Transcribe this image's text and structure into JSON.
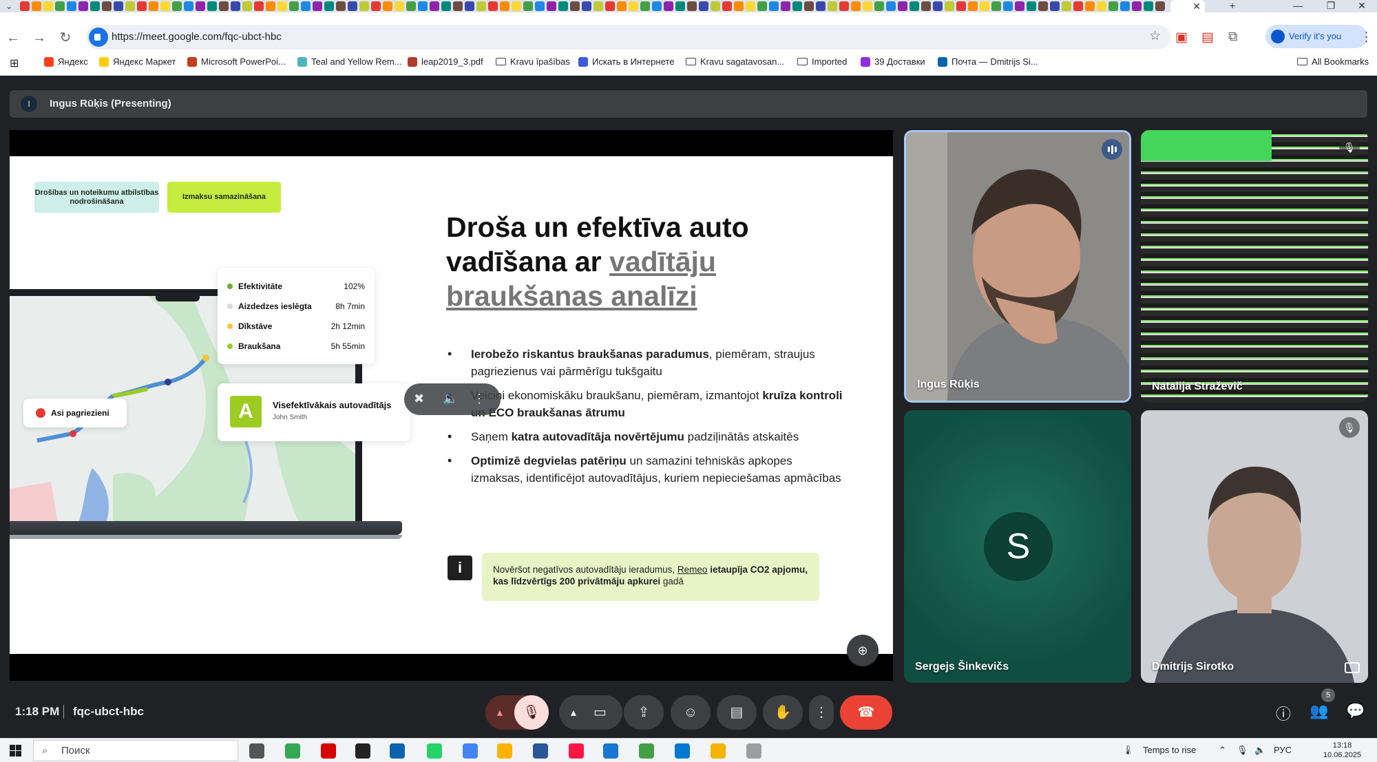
{
  "browser": {
    "url": "https://meet.google.com/fqc-ubct-hbc",
    "verify_label": "Verify it's you",
    "tab_close": "✕",
    "new_tab": "+",
    "bookmarks": [
      {
        "label": "Яндекс",
        "color": "#fc3f1d"
      },
      {
        "label": "Яндекс Маркет",
        "color": "#ffcc00"
      },
      {
        "label": "Microsoft PowerPoi...",
        "color": "#c43e1c"
      },
      {
        "label": "Teal and Yellow Rem...",
        "color": "#4fb3bf"
      },
      {
        "label": "leap2019_3.pdf",
        "color": "#b03a2e"
      },
      {
        "label": "Kravu īpašības",
        "folder": true
      },
      {
        "label": "Искать в Интернете",
        "color": "#3b5bdb"
      },
      {
        "label": "Kravu sagatavosan...",
        "folder": true
      },
      {
        "label": "Imported",
        "folder": true
      },
      {
        "label": "39 Доставки",
        "color": "#8e2de2"
      },
      {
        "label": "Почта — Dmitrijs Si...",
        "color": "#0a64ad"
      }
    ],
    "all_bookmarks": "All Bookmarks"
  },
  "meet": {
    "presenter_initial": "I",
    "presenting_label": "Ingus Rūķis (Presenting)",
    "meeting_time": "1:18 PM",
    "meeting_code": "fqc-ubct-hbc",
    "participants_count": "5",
    "participants": [
      {
        "name": "Ingus Rūķis",
        "speaking": true
      },
      {
        "name": "Natalija Straževič",
        "muted": true
      },
      {
        "name": "Sergejs Šinkevičs",
        "initial": "S"
      },
      {
        "name": "Dmitrijs Sirotko",
        "muted": true
      }
    ]
  },
  "slide": {
    "pill_1": "Drošibas un noteikumu atbilstības nodrošināšana",
    "pill_2": "Izmaksu samazināšana",
    "stats": [
      {
        "label": "Efektivitāte",
        "value": "102%",
        "color": "#6ab023"
      },
      {
        "label": "Aizdedzes ieslēgta",
        "value": "8h 7min",
        "color": "#d9d9d9"
      },
      {
        "label": "Dīkstāve",
        "value": "2h 12min",
        "color": "#f4c542"
      },
      {
        "label": "Braukšana",
        "value": "5h 55min",
        "color": "#9ccc22"
      }
    ],
    "driver_initial": "A",
    "driver_title": "Visefektīvākais autovadītājs",
    "driver_name": "John Smith",
    "tag_label": "Asi pagriezieni",
    "title_line_1": "Droša un efektīva auto",
    "title_line_2a": "vadīšana ar ",
    "title_line_2b": "vadītāju",
    "title_line_3": "braukšanas analīzi",
    "bullet_1_bold": "Ierobežo riskantus braukšanas paradumus",
    "bullet_1_rest": ", piemēram, straujus pagriezienus vai pārmērīgu tukšgaitu",
    "bullet_2_rest": "Veicini ekonomiskāku braukšanu, piemēram, izmantojot ",
    "bullet_2_bold": "kruīza kontroli un ECO braukšanas ātrumu",
    "bullet_3_a": "Saņem ",
    "bullet_3_bold": "katra autovadītāja novērtējumu",
    "bullet_3_b": " padziļinātās atskaitēs",
    "bullet_4_bold": "Optimizē degvielas patēriņu",
    "bullet_4_rest": " un samazini tehniskās apkopes izmaksas, identificējot autovadītājus, kuriem nepieciešamas apmācības",
    "info_icon": "i",
    "info_a": "Novēršot negatīvos autovadītāju ieradumus, ",
    "info_link": "Remeo",
    "info_bold": " ietaupīja CO2 apjomu, kas līdzvērtīgs 200 privātmāju apkurei",
    "info_b": " gadā"
  },
  "taskbar": {
    "search_placeholder": "Поиск",
    "weather": "Temps to rise",
    "lang": "РУС",
    "time": "13:18",
    "date": "10.06.2025"
  }
}
